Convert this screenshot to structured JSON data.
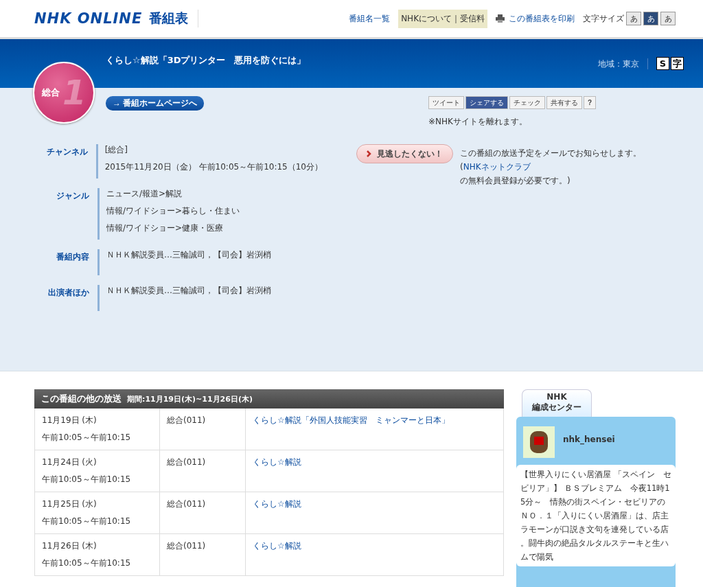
{
  "header": {
    "logo": "NHK ONLINE",
    "logo_sub": "番組表",
    "nav": [
      {
        "label": "番組名一覧",
        "kind": "link"
      },
      {
        "label": "NHKについて｜受信料",
        "kind": "box"
      }
    ],
    "print": "この番組表を印刷",
    "font_size_label": "文字サイズ",
    "font_sizes": [
      {
        "label": "あ",
        "selected": false
      },
      {
        "label": "あ",
        "selected": true
      },
      {
        "label": "あ",
        "selected": false
      }
    ]
  },
  "program": {
    "title": "くらし☆解説「3Dプリンター　悪用を防ぐには」",
    "channel_badge": "総合",
    "channel_number": "1",
    "region": "地域：東京",
    "caption_icons": [
      "S",
      "字"
    ],
    "homepage_arrow": "→",
    "homepage_button": "番組ホームページへ"
  },
  "share": {
    "buttons": [
      {
        "label": "ツイート",
        "kind": "twitter"
      },
      {
        "label": "シェアする",
        "kind": "facebook"
      },
      {
        "label": "チェック",
        "kind": "mixi"
      },
      {
        "label": "共有する",
        "kind": "plus"
      },
      {
        "label": "?",
        "kind": "help"
      }
    ],
    "note": "※NHKサイトを離れます。"
  },
  "details": [
    {
      "label": "チャンネル",
      "lines": [
        "[総合]",
        "2015年11月20日（金） 午前10:05～午前10:15（10分）"
      ]
    },
    {
      "label": "ジャンル",
      "lines": [
        "ニュース/報道>解説",
        "情報/ワイドショー>暮らし・住まい",
        "情報/ワイドショー>健康・医療"
      ]
    },
    {
      "label": "番組内容",
      "lines": [
        "ＮＨＫ解説委員…三輪誠司，【司会】岩渕梢"
      ]
    },
    {
      "label": "出演者ほか",
      "lines": [
        "ＮＨＫ解説委員…三輪誠司，【司会】岩渕梢"
      ]
    }
  ],
  "reminder": {
    "button": "見逃したくない！",
    "text": "この番組の放送予定をメールでお知らせします。(",
    "link": "NHKネットクラブ",
    "text_after": "の無料会員登録が必要です。)"
  },
  "other_broadcasts": {
    "title": "この番組の他の放送",
    "period": "期間:11月19日(木)~11月26日(木)",
    "rows": [
      {
        "date": "11月19日 (木)",
        "time": "午前10:05～午前10:15",
        "channel": "総合(011)",
        "program": "くらし☆解説「外国人技能実習　ミャンマーと日本」"
      },
      {
        "date": "11月24日 (火)",
        "time": "午前10:05～午前10:15",
        "channel": "総合(011)",
        "program": "くらし☆解説"
      },
      {
        "date": "11月25日 (水)",
        "time": "午前10:05～午前10:15",
        "channel": "総合(011)",
        "program": "くらし☆解説"
      },
      {
        "date": "11月26日 (木)",
        "time": "午前10:05～午前10:15",
        "channel": "総合(011)",
        "program": "くらし☆解説"
      }
    ]
  },
  "sidebar": {
    "tab": [
      "NHK",
      "編成センター"
    ],
    "account": "nhk_hensei",
    "tweet": "【世界入りにくい居酒屋 「スペイン　セビリア」】 ＢＳプレミアム　今夜11時15分～　情熱の街スペイン・セビリアのＮＯ．１「入りにくい居酒屋」は、店主ラモーンが口説き文句を連発している店。闘牛肉の絶品タルタルステーキと生ハムで陽気"
  }
}
